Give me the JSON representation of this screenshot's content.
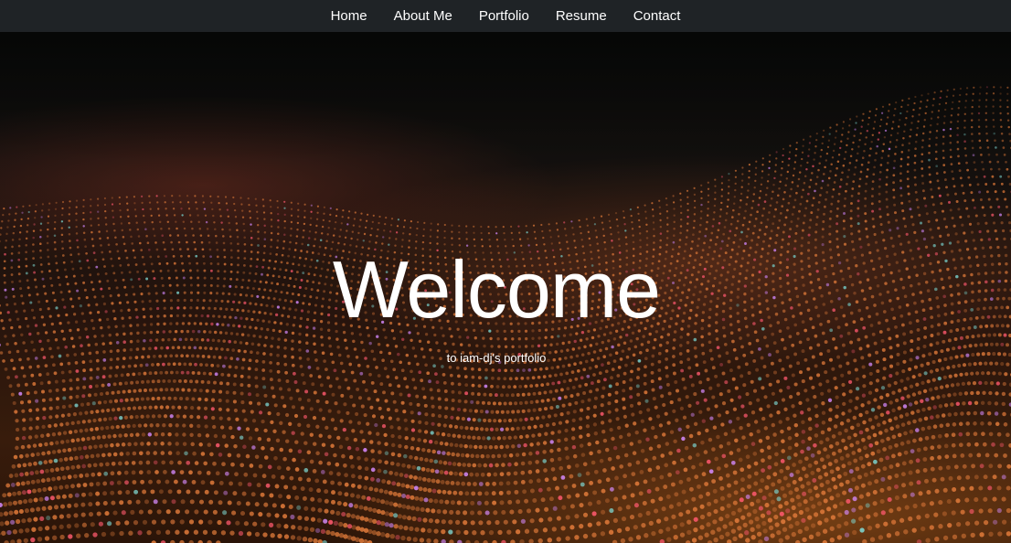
{
  "nav": {
    "items": [
      {
        "label": "Home"
      },
      {
        "label": "About Me"
      },
      {
        "label": "Portfolio"
      },
      {
        "label": "Resume"
      },
      {
        "label": "Contact"
      }
    ]
  },
  "hero": {
    "title": "Welcome",
    "subtitle": "to iam-dj's portfolio",
    "background_image": "abstract-particle-wave-image"
  },
  "colors": {
    "navbar_bg": "#1f2326",
    "nav_text": "#ffffff",
    "hero_text": "#ffffff",
    "accent_orange": "#ff8a3c",
    "accent_pink": "#ff5a6e"
  }
}
